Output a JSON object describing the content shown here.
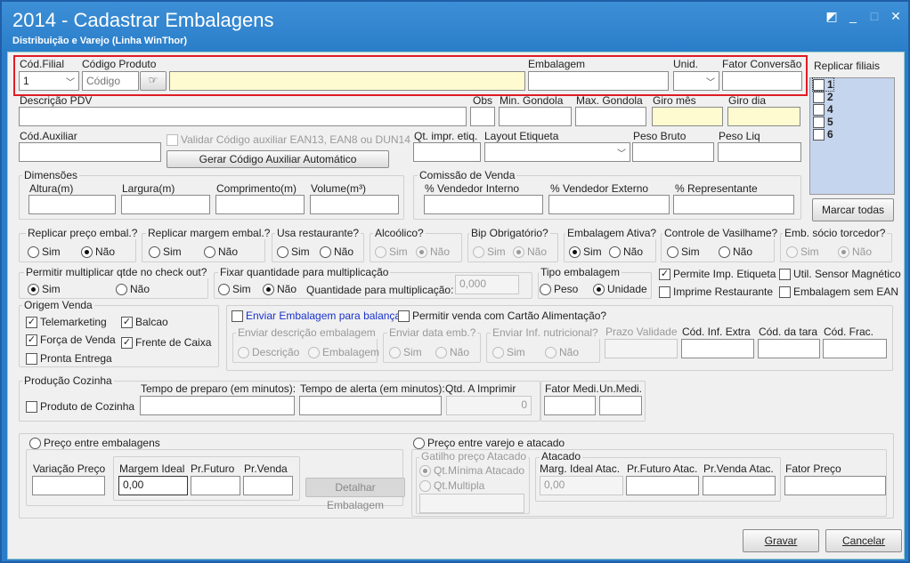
{
  "window": {
    "title": "2014 - Cadastrar Embalagens",
    "subtitle": "Distribuição e Varejo (Linha WinThor)",
    "controls": [
      "◩",
      "_",
      "□",
      "✕"
    ]
  },
  "top": {
    "cod_filial_label": "Cód.Filial",
    "cod_filial_value": "1",
    "codigo_produto_label": "Código Produto",
    "codigo_placeholder": "Código",
    "embalagem_label": "Embalagem",
    "unid_label": "Unid.",
    "fator_conversao_label": "Fator Conversão"
  },
  "replicar_filiais": {
    "label": "Replicar filiais",
    "items": [
      "1",
      "2",
      "4",
      "5",
      "6"
    ],
    "marcar_todas": "Marcar todas"
  },
  "row2": {
    "descricao_pdv": "Descrição PDV",
    "obs": "Obs",
    "min_gondola": "Min. Gondola",
    "max_gondola": "Max. Gondola",
    "giro_mes": "Giro mês",
    "giro_dia": "Giro dia"
  },
  "row3": {
    "cod_auxiliar": "Cód.Auxiliar",
    "validar": "Validar Código auxiliar EAN13, EAN8 ou DUN14",
    "gerar_btn": "Gerar Código Auxiliar Automático",
    "qt_impr": "Qt. impr. etiq.",
    "layout_etiqueta": "Layout Etiqueta",
    "peso_bruto": "Peso Bruto",
    "peso_liq": "Peso Liq"
  },
  "dimensoes": {
    "title": "Dimensões",
    "altura": "Altura(m)",
    "largura": "Largura(m)",
    "comprimento": "Comprimento(m)",
    "volume": "Volume(m³)"
  },
  "comissao": {
    "title": "Comissão de Venda",
    "interno": "% Vendedor Interno",
    "externo": "% Vendedor Externo",
    "representante": "% Representante"
  },
  "options_row": {
    "sim": "Sim",
    "nao": "Não",
    "replicar_preco": "Replicar preço embal.?",
    "replicar_margem": "Replicar margem embal.?",
    "usa_restaurante": "Usa restaurante?",
    "alcoolico": "Alcoólico?",
    "bip": "Bip Obrigatório?",
    "embalagem_ativa": "Embalagem Ativa?",
    "controle_vasilhame": "Controle de Vasilhame?",
    "emb_socio": "Emb. sócio torcedor?"
  },
  "multiplicar": {
    "permitir": "Permitir multiplicar qtde no check out?",
    "fixar": "Fixar quantidade para multiplicação",
    "quantidade": "Quantidade para multiplicação:",
    "quantidade_value": "0,000",
    "tipo": "Tipo embalagem",
    "peso": "Peso",
    "unidade": "Unidade",
    "permite_imp": "Permite Imp. Etiqueta",
    "util_sensor": "Util. Sensor Magnético",
    "imprime_rest": "Imprime Restaurante",
    "sem_ean": "Embalagem sem EAN"
  },
  "origem": {
    "title": "Origem Venda",
    "telemarketing": "Telemarketing",
    "balcao": "Balcao",
    "forca": "Força de Venda",
    "frente": "Frente de Caixa",
    "pronta": "Pronta Entrega"
  },
  "balanca": {
    "enviar": "Enviar Embalagem para balança",
    "cartao": "Permitir venda com Cartão Alimentação?",
    "descricao_grp": "Enviar descrição embalagem",
    "descricao": "Descrição",
    "embalagem": "Embalagem",
    "data_grp": "Enviar data emb.?",
    "inf_grp": "Enviar Inf. nutricional?",
    "prazo": "Prazo Validade",
    "cod_inf": "Cód. Inf. Extra",
    "cod_tara": "Cód. da tara",
    "cod_frac": "Cód. Frac."
  },
  "cozinha": {
    "title": "Produção Cozinha",
    "produto": "Produto de Cozinha",
    "preparo": "Tempo de preparo (em minutos):",
    "alerta": "Tempo de alerta (em minutos):",
    "qtd": "Qtd. A Imprimir",
    "qtd_value": "0",
    "fator_medi": "Fator Medi.",
    "un_medi": "Un.Medi."
  },
  "preco": {
    "entre_emb": "Preço entre embalagens",
    "variacao": "Variação Preço",
    "margem": "Margem Ideal",
    "margem_value": "0,00",
    "pr_futuro": "Pr.Futuro",
    "pr_venda": "Pr.Venda",
    "detalhar": "Detalhar Embalagem",
    "varejo_atacado": "Preço entre varejo e atacado",
    "gatilho": "Gatilho preço Atacado",
    "qt_minima": "Qt.Mínima Atacado",
    "qt_multipla": "Qt.Multipla",
    "atacado": "Atacado",
    "marg_atac": "Marg. Ideal Atac.",
    "marg_atac_value": "0,00",
    "pr_futuro_atac": "Pr.Futuro Atac.",
    "pr_venda_atac": "Pr.Venda Atac.",
    "fator_preco": "Fator Preço"
  },
  "footer": {
    "gravar": "Gravar",
    "cancelar": "Cancelar"
  }
}
